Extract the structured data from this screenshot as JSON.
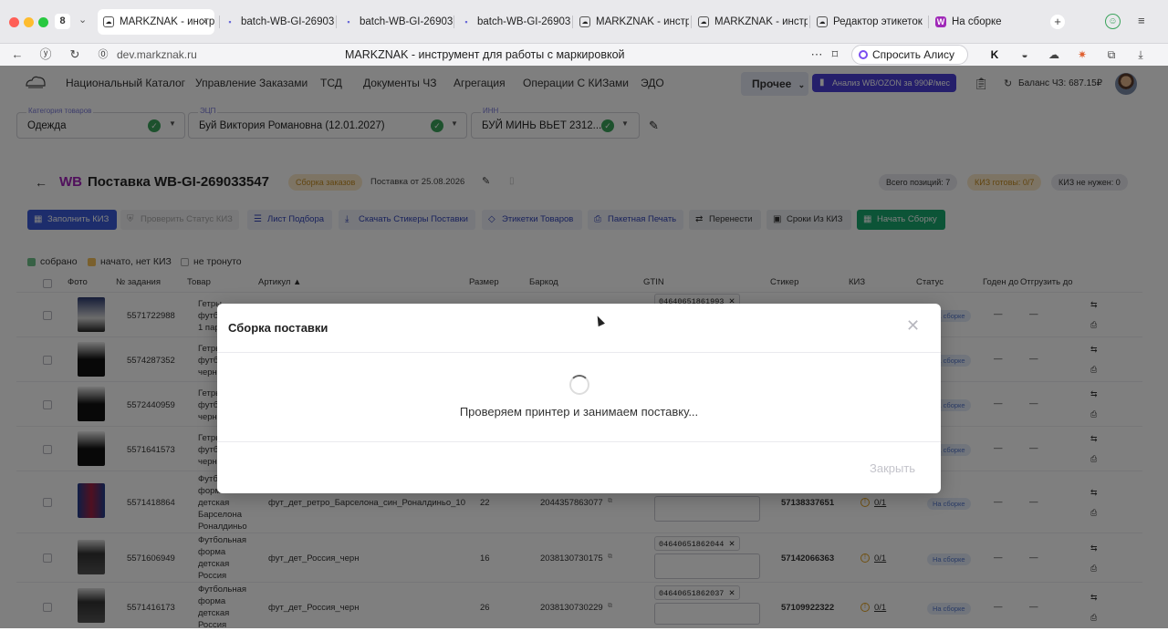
{
  "browser": {
    "tab_count": "8",
    "tabs": [
      {
        "label": "MARKZNAK - инстр",
        "icon": "markznak-icon",
        "active": true
      },
      {
        "label": "batch-WB-GI-26903354",
        "icon": "doc-icon"
      },
      {
        "label": "batch-WB-GI-26903354",
        "icon": "doc-icon"
      },
      {
        "label": "batch-WB-GI-26903354",
        "icon": "doc-icon"
      },
      {
        "label": "MARKZNAK - инструм",
        "icon": "markznak-icon"
      },
      {
        "label": "MARKZNAK - инструм",
        "icon": "markznak-icon"
      },
      {
        "label": "Редактор этикеток",
        "icon": "markznak-icon"
      },
      {
        "label": "На сборке",
        "icon": "wb-icon"
      }
    ],
    "url": "dev.markznak.ru",
    "page_title": "MARKZNAK - инструмент для работы с маркировкой",
    "alice_label": "Спросить Алису AI"
  },
  "app": {
    "nav": [
      "Национальный Каталог",
      "Управление Заказами",
      "ТСД",
      "Документы ЧЗ",
      "Агрегация",
      "Операции С КИЗами",
      "ЭДО"
    ],
    "more_label": "Прочее",
    "analysis_label": "Анализ WB/OZON за 990₽/мес",
    "balance_label": "Баланс ЧЗ: 687.15₽"
  },
  "filters": {
    "category": {
      "label": "Категория товаров",
      "value": "Одежда"
    },
    "ecp": {
      "label": "ЭЦП",
      "value": "Буй Виктория Романовна (12.01.2027)"
    },
    "inn": {
      "label": "ИНН",
      "value": "БУЙ МИНЬ ВЬЕТ 2312..."
    }
  },
  "supply": {
    "marketplace": "WB",
    "title": "Поставка WB-GI-269033547",
    "status_chip": "Сборка заказов",
    "date_label": "Поставка от 25.08.2026",
    "counters": {
      "total": "Всего позиций: 7",
      "kiz_ready": "КИЗ готовы: 0/7",
      "kiz_not_needed": "КИЗ не нужен: 0"
    }
  },
  "toolbar": {
    "fill_kiz": "Заполнить КИЗ",
    "check_kiz": "Проверить Статус КИЗ",
    "picking_list": "Лист Подбора",
    "download_stickers": "Скачать Стикеры Поставки",
    "product_labels": "Этикетки Товаров",
    "batch_print": "Пакетная Печать",
    "move": "Перенести",
    "kiz_dates": "Сроки Из КИЗ",
    "start_assembly": "Начать Сборку"
  },
  "legend": {
    "collected": "собрано",
    "started": "начато, нет КИЗ",
    "untouched": "не тронуто"
  },
  "table": {
    "headers": {
      "photo": "Фото",
      "task": "№ задания",
      "product": "Товар",
      "article": "Артикул ▲",
      "size": "Размер",
      "barcode": "Баркод",
      "gtin": "GTIN",
      "sticker": "Стикер",
      "kiz": "КИЗ",
      "status": "Статус",
      "valid": "Годен до",
      "ship": "Отгрузить до"
    },
    "rows": [
      {
        "task": "5571722988",
        "product": [
          "Гетры",
          "футб",
          "1 пар"
        ],
        "article": "",
        "size": "",
        "barcode": "",
        "gtin": "04640651861993",
        "sticker": "",
        "kiz": "",
        "status": "На сборке",
        "valid": "—",
        "ship": "—"
      },
      {
        "task": "5574287352",
        "product": [
          "Гетры",
          "футб",
          "черн"
        ],
        "article": "",
        "size": "",
        "barcode": "",
        "gtin": "",
        "sticker": "",
        "kiz": "",
        "status": "На сборке",
        "valid": "—",
        "ship": "—"
      },
      {
        "task": "5572440959",
        "product": [
          "Гетры",
          "футб",
          "черн"
        ],
        "article": "",
        "size": "",
        "barcode": "",
        "gtin": "",
        "sticker": "",
        "kiz": "",
        "status": "На сборке",
        "valid": "—",
        "ship": "—"
      },
      {
        "task": "5571641573",
        "product": [
          "Гетры",
          "футб",
          "черн"
        ],
        "article": "",
        "size": "",
        "barcode": "",
        "gtin": "",
        "sticker": "",
        "kiz": "",
        "status": "На сборке",
        "valid": "—",
        "ship": "—"
      },
      {
        "task": "5571418864",
        "product": [
          "Футбольная",
          "форма",
          "детская",
          "Барселона",
          "Роналдиньо"
        ],
        "article": "фут_дет_ретро_Барселона_син_Роналдиньо_10",
        "size": "22",
        "barcode": "2044357863077",
        "gtin": "",
        "sticker": "57138337651",
        "kiz": "0/1",
        "status": "На сборке",
        "valid": "—",
        "ship": "—"
      },
      {
        "task": "5571606949",
        "product": [
          "Футбольная",
          "форма",
          "детская",
          "Россия"
        ],
        "article": "фут_дет_Россия_черн",
        "size": "16",
        "barcode": "2038130730175",
        "gtin": "04640651862044",
        "sticker": "57142066363",
        "kiz": "0/1",
        "status": "На сборке",
        "valid": "—",
        "ship": "—"
      },
      {
        "task": "5571416173",
        "product": [
          "Футбольная",
          "форма",
          "детская",
          "Россия"
        ],
        "article": "фут_дет_Россия_черн",
        "size": "26",
        "barcode": "2038130730229",
        "gtin": "04640651862037",
        "sticker": "57109922322",
        "kiz": "0/1",
        "status": "На сборке",
        "valid": "—",
        "ship": "—"
      }
    ]
  },
  "modal": {
    "title": "Сборка поставки",
    "message": "Проверяем принтер и занимаем поставку...",
    "close_label": "Закрыть"
  }
}
